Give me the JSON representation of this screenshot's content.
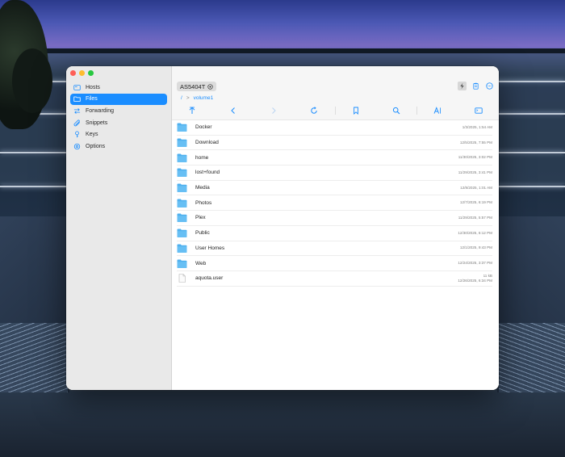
{
  "window": {
    "controls": {
      "close_icon": "close-icon",
      "minimize_icon": "minimize-icon",
      "zoom_icon": "zoom-icon"
    }
  },
  "sidebar": {
    "items": [
      {
        "label": "Hosts",
        "icon": "hosts-icon",
        "active": false
      },
      {
        "label": "Files",
        "icon": "folder-icon",
        "active": true
      },
      {
        "label": "Forwarding",
        "icon": "forwarding-icon",
        "active": false
      },
      {
        "label": "Snippets",
        "icon": "snippets-icon",
        "active": false
      },
      {
        "label": "Keys",
        "icon": "key-icon",
        "active": false
      },
      {
        "label": "Options",
        "icon": "gear-icon",
        "active": false
      }
    ]
  },
  "header": {
    "host": "AS5404T",
    "host_icon": "chevron-circle-icon",
    "actions": [
      "bolt-icon",
      "clipboard-icon",
      "more-icon"
    ]
  },
  "breadcrumb": {
    "root": "/",
    "separator": ">",
    "current": "volume1"
  },
  "toolbar": {
    "icons": [
      "up-arrow-icon",
      "back-icon",
      "forward-icon",
      "refresh-icon",
      "bookmark-icon",
      "search-icon",
      "text-size-icon",
      "terminal-icon"
    ]
  },
  "files": [
    {
      "name": "Docker",
      "type": "folder",
      "size": "",
      "modified": "1/3/2025, 1:54 AM"
    },
    {
      "name": "Download",
      "type": "folder",
      "size": "",
      "modified": "12/5/2025, 7:55 PM"
    },
    {
      "name": "home",
      "type": "folder",
      "size": "",
      "modified": "11/30/2025, 3:02 PM"
    },
    {
      "name": "lost+found",
      "type": "folder",
      "size": "",
      "modified": "11/29/2025, 3:41 PM"
    },
    {
      "name": "Media",
      "type": "folder",
      "size": "",
      "modified": "12/8/2025, 1:01 AM"
    },
    {
      "name": "Photos",
      "type": "folder",
      "size": "",
      "modified": "12/7/2025, 6:19 PM"
    },
    {
      "name": "Plex",
      "type": "folder",
      "size": "",
      "modified": "11/29/2025, 5:57 PM"
    },
    {
      "name": "Public",
      "type": "folder",
      "size": "",
      "modified": "12/30/2025, 6:12 PM"
    },
    {
      "name": "User Homes",
      "type": "folder",
      "size": "",
      "modified": "12/1/2025, 9:43 PM"
    },
    {
      "name": "Web",
      "type": "folder",
      "size": "",
      "modified": "12/24/2025, 3:37 PM"
    },
    {
      "name": "aquota.user",
      "type": "file",
      "size": "11 kB",
      "modified": "12/26/2025, 6:34 PM"
    }
  ],
  "colors": {
    "accent": "#1a8dff",
    "folder": "#4fb0ef",
    "sidebar_bg": "#e9e9e9"
  }
}
